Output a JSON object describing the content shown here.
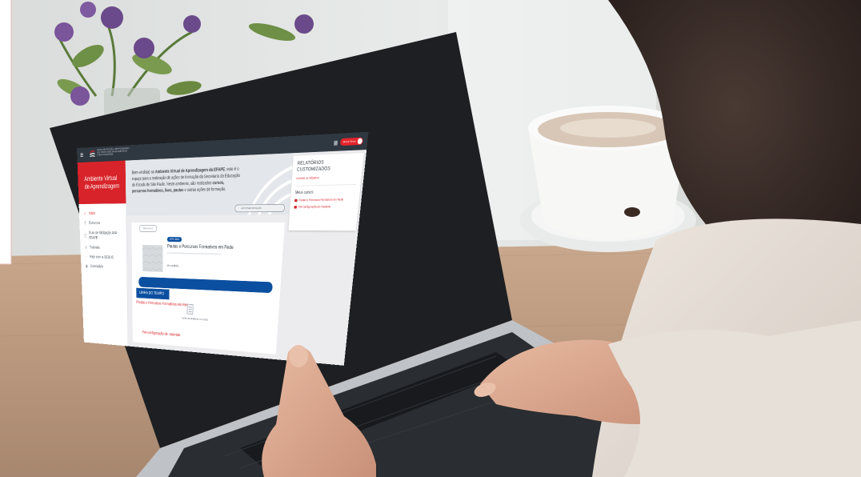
{
  "header": {
    "logo_text": "ESCOLA DE FORMAÇÃO E APERFEIÇOAMENTO DOS PROFISSIONAIS DA EDUCAÇÃO PAULO RENATO COSTA SOUZA",
    "user_name": "Bruna Tevec"
  },
  "sidebar": {
    "title": "Ambiente Virtual de Aprendizagem",
    "items": [
      {
        "label": "Início",
        "icon": "home-icon",
        "active": true
      },
      {
        "label": "Estrutura",
        "icon": "structure-icon",
        "active": false
      },
      {
        "label": "Guia de Utilização AVA-EFAPE",
        "icon": "guide-icon",
        "active": false
      },
      {
        "label": "Tutoriais",
        "icon": "tutorial-icon",
        "active": false
      },
      {
        "label": "Fale com a SEDUC",
        "icon": "chat-icon",
        "active": false
      },
      {
        "label": "Calendário",
        "icon": "calendar-icon",
        "active": false
      }
    ]
  },
  "banner": {
    "welcome_prefix": "Bem-vindo(a) ao ",
    "welcome_strong": "Ambiente Virtual de Aprendizagem da EFAPE",
    "welcome_rest": ", este é o espaço para a realização de ações de formação da Secretaria da Educação do Estado de São Paulo. Neste ambiente, são realizados ",
    "welcome_strong2": "cursos, percursos formativos, lives, pautas",
    "welcome_end": " e outras ações de formação.",
    "rotate_button": "ALTERNAR ROTAÇÃO"
  },
  "right_panel": {
    "title": "RELATÓRIOS CUSTOMIZADOS",
    "link": "Acessar os relatórios",
    "my_courses": "Meus cursos",
    "courses": [
      "Pautas e Percursos Formativos em Rede",
      "Pré-configuração de materiais"
    ]
  },
  "main": {
    "filter_pill": "Meus cursos",
    "course_tag": "ATPC 2022",
    "course_title": "Pautas e Percursos Formativos em Rede",
    "progress_text": "0% concluído",
    "progress": 0.0
  },
  "timeline": {
    "tab_label": "LINHA DO TEMPO",
    "course": "Pautas e Percursos Formativos em Rede",
    "note": "Nenhuma atividade com prazo",
    "subcourse": "Pré-configuração de materiais"
  },
  "colors": {
    "accent_red": "#d8232a",
    "accent_blue": "#0b4fa0",
    "topbar": "#2f3740"
  }
}
